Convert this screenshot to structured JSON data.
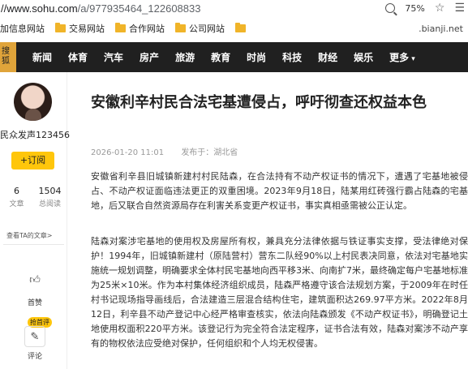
{
  "browser": {
    "url_prefix": "//www.sohu.com",
    "url_path": "/a/977935464_122608833",
    "zoom": "75%"
  },
  "bookmarks": {
    "items": [
      "加信息网站",
      "交易网站",
      "合作网站",
      "公司网站"
    ],
    "right_text": ".bianji.net"
  },
  "nav": {
    "logo_text": "搜狐",
    "links": [
      "新闻",
      "体育",
      "汽车",
      "房产",
      "旅游",
      "教育",
      "时尚",
      "科技",
      "财经",
      "娱乐",
      "更多"
    ]
  },
  "author": {
    "name": "民众发声123456",
    "follow_label": "+订阅",
    "stats": [
      {
        "value": "6",
        "label": "文章"
      },
      {
        "value": "1504",
        "label": "总阅读"
      }
    ],
    "see_all": "查看TA的文章>",
    "like_label": "首赞",
    "comment_label": "评论",
    "hot_badge": "抢首评"
  },
  "article": {
    "title": "安徽利辛村民合法宅基遭侵占，呼吁彻查还权益本色",
    "date": "2026-01-20 11:01",
    "source": "发布于：湖北省",
    "paragraphs": [
      "安徽省利辛县旧城镇新建村村民陆森，在合法持有不动产权证书的情况下，遭遇了宅基地被侵占、不动产权证面临违法更正的双重困境。2023年9月18日，陆某用红砖强行霸占陆森的宅基地，后又联合自然资源局存在利害关系变更产权证书，事实真相亟需被公正认定。",
      "陆森对案涉宅基地的使用权及房屋所有权，兼具充分法律依据与铁证事实支撑，受法律绝对保护！1994年，旧城镇新建村（原陆营村）营东二队经90%以上村民表决同意，依法对宅基地实施统一规划调整，明确要求全体村民宅基地向西平移3米、向南扩7米，最终确定每户宅基地标准为25米×10米。作为本村集体经济组织成员，陆森严格遵守该合法规划方案，于2009年在时任村书记现场指导画线后，合法建造三层混合结构住宅，建筑面积达269.97平方米。2022年8月12日，利辛县不动产登记中心经严格审查核实，依法向陆森颁发《不动产权证书》，明确登记土地使用权面积220平方米。该登记行为完全符合法定程序，证书合法有效，陆森对案涉不动产享有的物权依法应受绝对保护，任何组织和个人均无权侵害。"
    ]
  }
}
